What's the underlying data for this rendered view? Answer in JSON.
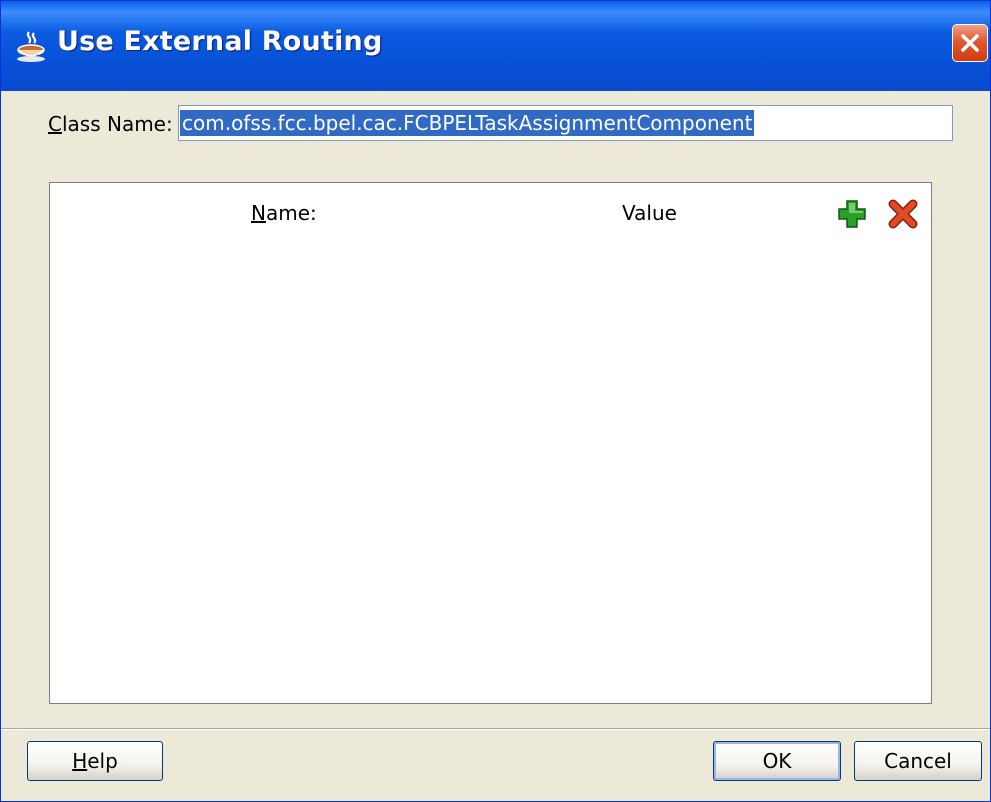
{
  "window": {
    "title": "Use External Routing",
    "icon": "coffee-cup-icon",
    "close_icon": "close-icon"
  },
  "class_name": {
    "label_mnemonic": "C",
    "label_rest": "lass Name:",
    "value": "com.ofss.fcc.bpel.cac.FCBPELTaskAssignmentComponent"
  },
  "table": {
    "col_name_mnemonic": "N",
    "col_name_rest": "ame:",
    "col_value": "Value",
    "add_icon": "add-icon",
    "delete_icon": "delete-icon",
    "rows": []
  },
  "buttons": {
    "help_mnemonic": "H",
    "help_rest": "elp",
    "ok": "OK",
    "cancel": "Cancel"
  },
  "colors": {
    "titlebar": "#0a5ae0",
    "selection": "#316ac5",
    "add_green": "#2aa02a",
    "delete_red": "#d83b1a"
  }
}
